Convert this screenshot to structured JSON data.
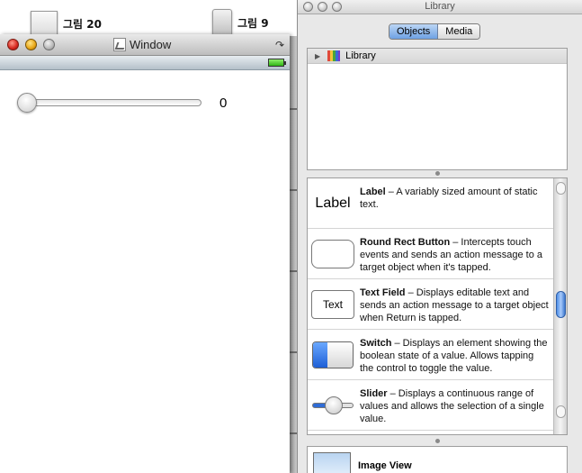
{
  "desktop": {
    "items": [
      {
        "label": "그림 20",
        "icon": "screenshot-thumbnail"
      },
      {
        "label": "그림 9",
        "icon": "phone-thumbnail"
      }
    ]
  },
  "window": {
    "title": "Window",
    "slider_value": 0,
    "value_label": "0"
  },
  "library": {
    "title": "Library",
    "tabs": [
      {
        "label": "Objects",
        "active": true
      },
      {
        "label": "Media",
        "active": false
      }
    ],
    "tree": {
      "label": "Library"
    },
    "items": [
      {
        "name": "Label",
        "preview": "Label",
        "desc": " – A variably sized amount of static text."
      },
      {
        "name": "Round Rect Button",
        "preview": "",
        "desc": " – Intercepts touch events and sends an action message to a target object when it's tapped."
      },
      {
        "name": "Text Field",
        "preview": "Text",
        "desc": " – Displays editable text and sends an action message to a target object when Return is tapped."
      },
      {
        "name": "Switch",
        "preview": "",
        "desc": " – Displays an element showing the boolean state of a value. Allows tapping the control to toggle the value."
      },
      {
        "name": "Slider",
        "preview": "",
        "desc": " – Displays a continuous range of values and allows the selection of a single value."
      }
    ],
    "detail": {
      "name": "Image View"
    }
  },
  "colors": {
    "accent": "#6ea1e3",
    "switch_on": "#1e5fd6",
    "battery": "#2fb516"
  }
}
